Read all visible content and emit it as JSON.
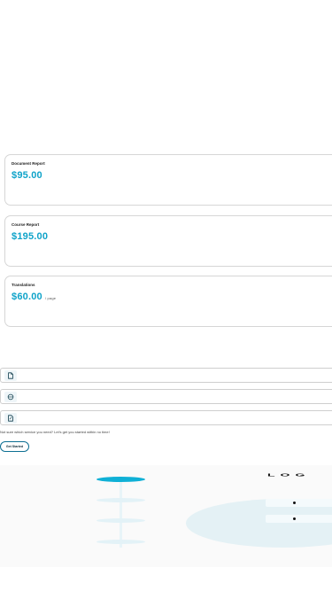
{
  "services": [
    {
      "title": "Document Report",
      "price": "$95.00",
      "per": ""
    },
    {
      "title": "Course Report",
      "price": "$195.00",
      "per": ""
    },
    {
      "title": "Translations",
      "price": "$60.00",
      "per": "/ page"
    }
  ],
  "service_rows": [
    {
      "icon": "document-icon"
    },
    {
      "icon": "globe-icon"
    },
    {
      "icon": "document-edit-icon"
    }
  ],
  "hint_text": "Not sure which service you need? Let's get you started within no time!",
  "cta_label": "Get Started",
  "illustration_logo_text": "LOG",
  "colors": {
    "accent": "#0fa3c9",
    "button_border": "#0d6f93",
    "border": "#d6d6d6"
  }
}
